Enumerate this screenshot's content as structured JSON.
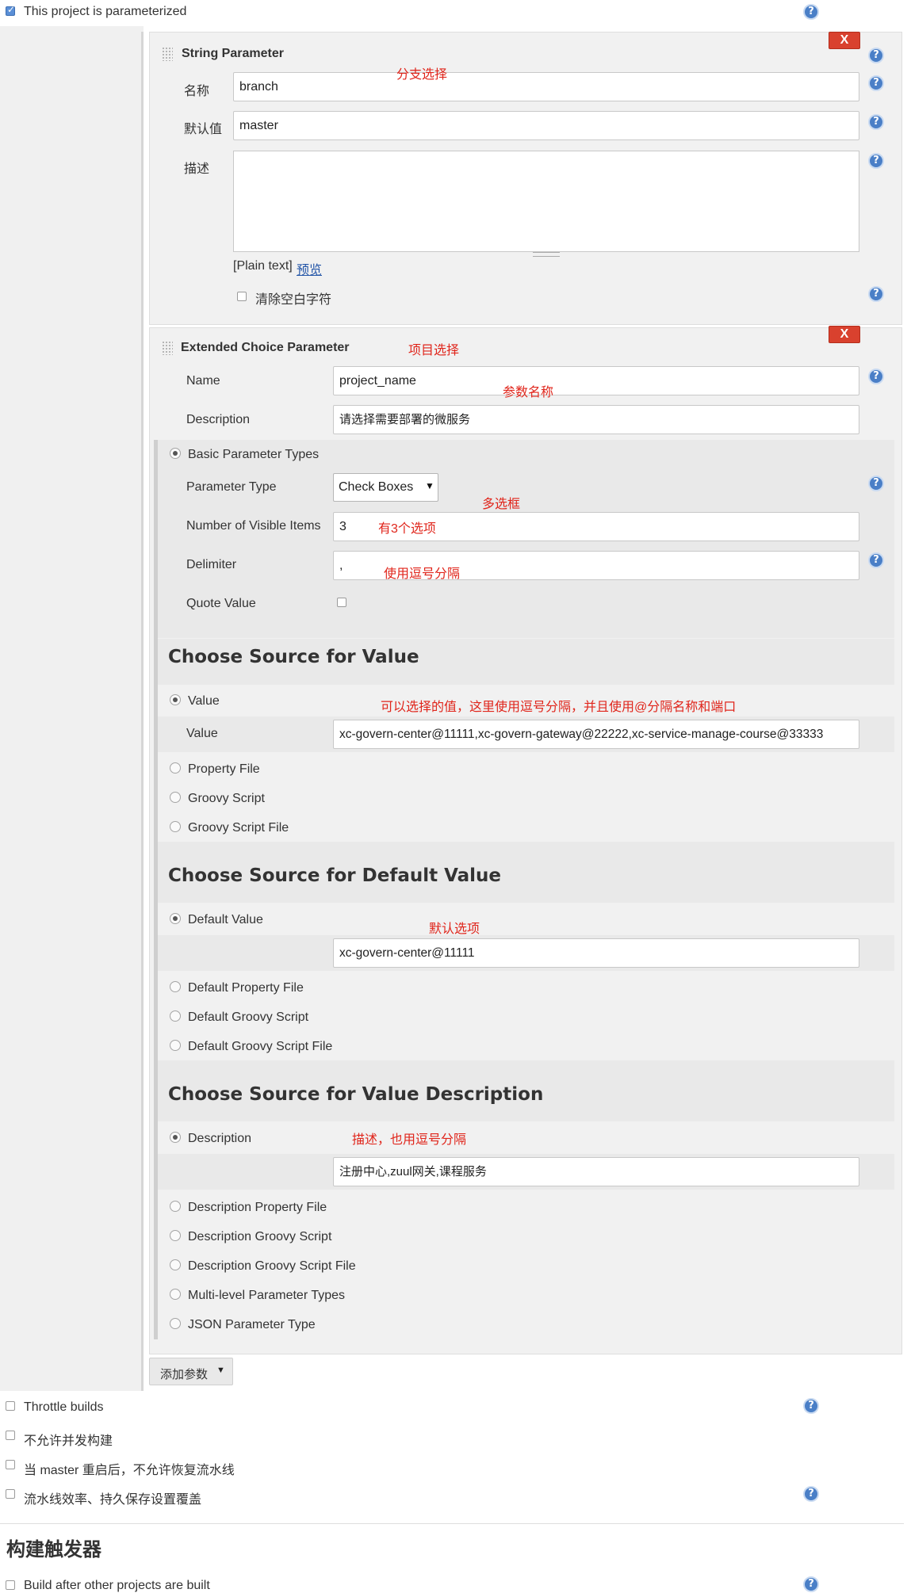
{
  "top": {
    "parameterized_label": "This project is parameterized",
    "parameterized_checked": true
  },
  "string_param": {
    "title": "String Parameter",
    "close_label": "X",
    "name_label": "名称",
    "name_value": "branch",
    "name_note": "分支选择",
    "default_label": "默认值",
    "default_value": "master",
    "desc_label": "描述",
    "desc_value": "",
    "plain_text": "[Plain text]",
    "preview_link": "预览",
    "trim_label": "清除空白字符"
  },
  "ext_param": {
    "title": "Extended Choice Parameter",
    "title_note": "项目选择",
    "close_label": "X",
    "name_label": "Name",
    "name_value": "project_name",
    "name_note": "参数名称",
    "desc_label": "Description",
    "desc_value": "请选择需要部署的微服务",
    "basic_types_label": "Basic Parameter Types",
    "param_type_label": "Parameter Type",
    "param_type_value": "Check Boxes",
    "param_type_note": "多选框",
    "visible_items_label": "Number of Visible Items",
    "visible_items_value": "3",
    "visible_items_note": "有3个选项",
    "delimiter_label": "Delimiter",
    "delimiter_value": ",",
    "delimiter_note": "使用逗号分隔",
    "quote_label": "Quote Value"
  },
  "source_value": {
    "heading": "Choose Source for Value",
    "value_radio": "Value",
    "value_note": "可以选择的值，这里使用逗号分隔，并且使用@分隔名称和端口",
    "value_label": "Value",
    "value_value": "xc-govern-center@11111,xc-govern-gateway@22222,xc-service-manage-course@33333",
    "property_file": "Property File",
    "groovy_script": "Groovy Script",
    "groovy_script_file": "Groovy Script File"
  },
  "source_default": {
    "heading": "Choose Source for Default Value",
    "default_radio": "Default Value",
    "default_note": "默认选项",
    "default_value": "xc-govern-center@11111",
    "default_property_file": "Default Property File",
    "default_groovy_script": "Default Groovy Script",
    "default_groovy_script_file": "Default Groovy Script File"
  },
  "source_desc": {
    "heading": "Choose Source for Value Description",
    "desc_radio": "Description",
    "desc_note": "描述，也用逗号分隔",
    "desc_value": "注册中心,zuul网关,课程服务",
    "desc_property_file": "Description Property File",
    "desc_groovy_script": "Description Groovy Script",
    "desc_groovy_script_file": "Description Groovy Script File",
    "multi_level": "Multi-level Parameter Types",
    "json_type": "JSON Parameter Type"
  },
  "add_param_label": "添加参数",
  "options": {
    "throttle": "Throttle builds",
    "no_concurrent": "不允许并发构建",
    "no_resume": "当 master 重启后，不允许恢复流水线",
    "durability": "流水线效率、持久保存设置覆盖"
  },
  "triggers": {
    "heading": "构建触发器",
    "build_after": "Build after other projects are built"
  },
  "colors": {
    "annotation_red": "#e0251b",
    "help_blue": "#4a7fc7",
    "close_red": "#d9412e",
    "panel_bg": "#f1f1f1",
    "band_bg": "#e9e9e9"
  }
}
